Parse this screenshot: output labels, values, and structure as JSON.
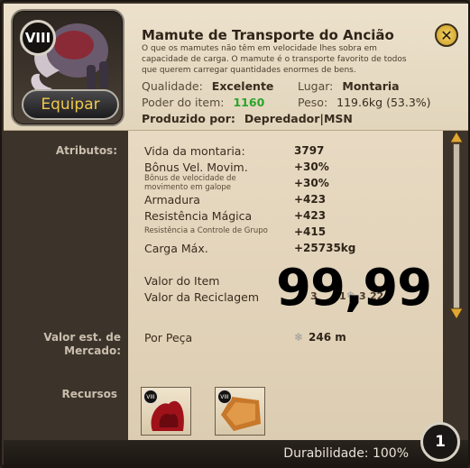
{
  "item": {
    "tier": "VIII",
    "equip_label": "Equipar",
    "title": "Mamute de Transporte do Ancião",
    "description": "O que os mamutes não têm em velocidade lhes sobra em capacidade de carga. O mamute é o transporte favorito de todos que querem carregar quantidades enormes de bens.",
    "quality_label": "Qualidade:",
    "quality_value": "Excelente",
    "location_label": "Lugar:",
    "location_value": "Montaria",
    "power_label": "Poder do item:",
    "power_value": "1160",
    "weight_label": "Peso:",
    "weight_value": "119.6kg (53.3%)",
    "crafter_label": "Produzido por:",
    "crafter_value": "Depredador|MSN"
  },
  "attributes": {
    "section_label": "Atributos:",
    "rows": [
      {
        "name": "Vida da montaria:",
        "value": "3797"
      },
      {
        "name": "Bônus Vel. Movim.",
        "value": "+30%"
      },
      {
        "name": "Bônus de velocidade de movimento em galope",
        "value": "+30%"
      },
      {
        "name": "Armadura",
        "value": "+423"
      },
      {
        "name": "Resistência Mágica",
        "value": "+423"
      },
      {
        "name": "Resistência a Controle de Grupo",
        "value": "+415"
      },
      {
        "name": "Carga Máx.",
        "value": "+25735kg"
      }
    ]
  },
  "values": {
    "item_value_label": "Valor do Item",
    "salvage_value_label": "Valor da Reciclagem",
    "partial_value_1": "3",
    "partial_value_2": "1",
    "partial_value_3": "3",
    "partial_value_4": "22",
    "price_overlay": "99,99"
  },
  "market": {
    "section_label": "Valor est. de Mercado:",
    "per_piece_label": "Por Peça",
    "per_piece_value": "246 m"
  },
  "resources": {
    "section_label": "Recursos",
    "items": [
      {
        "tier": "VIII",
        "icon": "red-fabric-resource-icon"
      },
      {
        "tier": "VIII",
        "icon": "leather-resource-icon"
      }
    ]
  },
  "footer": {
    "durability_label": "Durabilidade: 100%",
    "stack_count": "1"
  },
  "colors": {
    "power_value": "#2aa52a",
    "equip_text": "#f0c84c",
    "close_button": "#e8b637"
  },
  "icons": [
    "close-icon",
    "scroll-up-icon",
    "scroll-down-icon",
    "silver-coin-icon"
  ]
}
